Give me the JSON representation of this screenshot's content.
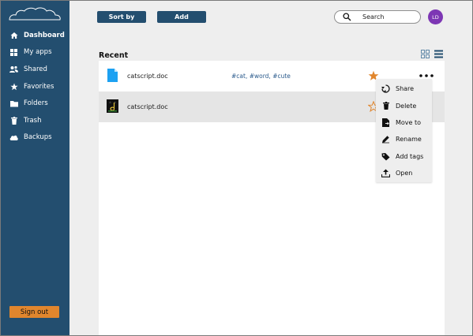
{
  "sidebar": {
    "logo_icon": "cloud-logo-icon",
    "items": [
      {
        "label": "Dashboard",
        "icon": "home-icon",
        "active": true
      },
      {
        "label": "My apps",
        "icon": "grid-icon"
      },
      {
        "label": "Shared",
        "icon": "users-icon"
      },
      {
        "label": "Favorites",
        "icon": "star-icon"
      },
      {
        "label": "Folders",
        "icon": "folder-icon"
      },
      {
        "label": "Trash",
        "icon": "trash-icon"
      },
      {
        "label": "Backups",
        "icon": "cloud-icon"
      }
    ],
    "sign_out_label": "Sign out"
  },
  "toolbar": {
    "sort_label": "Sort by",
    "add_label": "Add"
  },
  "search": {
    "placeholder": "Search",
    "icon": "search-icon"
  },
  "user": {
    "initials": "LD"
  },
  "recent": {
    "title": "Recent",
    "view_icons": [
      "grid-view-icon",
      "list-view-icon"
    ],
    "files": [
      {
        "name": "catscript.doc",
        "tags": "#cat, #word, #cute",
        "favorite": true,
        "icon": "document-icon"
      },
      {
        "name": "catscript.doc",
        "tags": "",
        "favorite": false,
        "icon": "cat-thumbnail-icon",
        "selected": true
      }
    ]
  },
  "context_menu": {
    "items": [
      {
        "label": "Share",
        "icon": "share-icon"
      },
      {
        "label": "Delete",
        "icon": "trash-icon"
      },
      {
        "label": "Move to",
        "icon": "move-file-icon"
      },
      {
        "label": "Rename",
        "icon": "pencil-icon"
      },
      {
        "label": "Add tags",
        "icon": "tag-icon"
      },
      {
        "label": "Open",
        "icon": "upload-icon"
      }
    ]
  },
  "colors": {
    "sidebar": "#234e6f",
    "accent_button": "#234e6f",
    "sign_out": "#e1862d",
    "star": "#e1862d",
    "avatar": "#7d36b4",
    "tag_text": "#2a5a8c",
    "background": "#eeeeee"
  }
}
